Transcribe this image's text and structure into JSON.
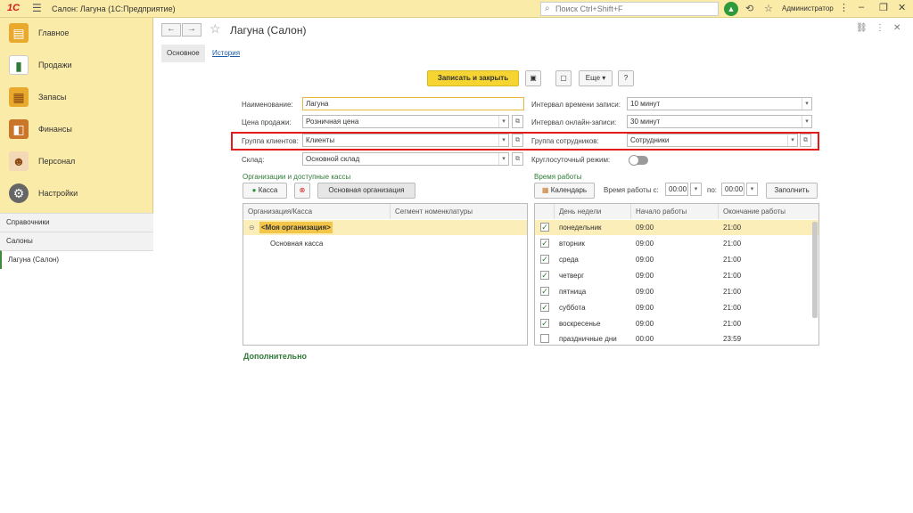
{
  "titlebar": {
    "logo": "1С",
    "title": "Салон: Лагуна  (1С:Предприятие)",
    "search_placeholder": "Поиск Ctrl+Shift+F",
    "user": "Администратор"
  },
  "sidebar": {
    "items": [
      {
        "label": "Главное",
        "icon": "home-icon"
      },
      {
        "label": "Продажи",
        "icon": "chart-icon"
      },
      {
        "label": "Запасы",
        "icon": "boxes-icon"
      },
      {
        "label": "Финансы",
        "icon": "wallet-icon"
      },
      {
        "label": "Персонал",
        "icon": "people-icon"
      },
      {
        "label": "Настройки",
        "icon": "gear-icon"
      }
    ],
    "links": [
      "Справочники",
      "Салоны",
      "Лагуна (Салон)"
    ]
  },
  "form": {
    "title": "Лагуна (Салон)",
    "tabs": [
      "Основное",
      "История"
    ],
    "toolbar": {
      "save_close": "Записать и закрыть",
      "more": "Еще",
      "help": "?"
    },
    "left_fields": {
      "name_label": "Наименование:",
      "name_value": "Лагуна",
      "price_label": "Цена продажи:",
      "price_value": "Розничная цена",
      "client_group_label": "Группа клиентов:",
      "client_group_value": "Клиенты",
      "warehouse_label": "Склад:",
      "warehouse_value": "Основной склад"
    },
    "right_fields": {
      "interval_label": "Интервал времени записи:",
      "interval_value": "10 минут",
      "online_label": "Интервал онлайн-записи:",
      "online_value": "30 минут",
      "staff_group_label": "Группа сотрудников:",
      "staff_group_value": "Сотрудники",
      "round_clock_label": "Круглосуточный режим:"
    },
    "orgs": {
      "header": "Организации и доступные кассы",
      "add_cash": "Касса",
      "main_org": "Основная организация",
      "columns": [
        "Организация/Касса",
        "Сегмент номенклатуры"
      ],
      "rows": [
        {
          "name": "<Моя организация>",
          "segment": ""
        },
        {
          "name": "Основная касса",
          "segment": ""
        }
      ]
    },
    "schedule": {
      "header": "Время работы",
      "calendar": "Календарь",
      "work_time_label": "Время работы с:",
      "from": "00:00",
      "to_label": "по:",
      "to": "00:00",
      "fill": "Заполнить",
      "columns": [
        "День недели",
        "Начало работы",
        "Окончание работы"
      ],
      "rows": [
        {
          "day": "понедельник",
          "start": "09:00",
          "end": "21:00",
          "checked": true
        },
        {
          "day": "вторник",
          "start": "09:00",
          "end": "21:00",
          "checked": true
        },
        {
          "day": "среда",
          "start": "09:00",
          "end": "21:00",
          "checked": true
        },
        {
          "day": "четверг",
          "start": "09:00",
          "end": "21:00",
          "checked": true
        },
        {
          "day": "пятница",
          "start": "09:00",
          "end": "21:00",
          "checked": true
        },
        {
          "day": "суббота",
          "start": "09:00",
          "end": "21:00",
          "checked": true
        },
        {
          "day": "воскресенье",
          "start": "09:00",
          "end": "21:00",
          "checked": true
        },
        {
          "day": "праздничные дни",
          "start": "00:00",
          "end": "23:59",
          "checked": false
        }
      ]
    },
    "additional": "Дополнительно"
  },
  "colors": {
    "sidebar_bg": "#fbeba8",
    "primary_button": "#f6d533",
    "highlight_box": "#e41b1b",
    "accent_green": "#2f7a36"
  }
}
